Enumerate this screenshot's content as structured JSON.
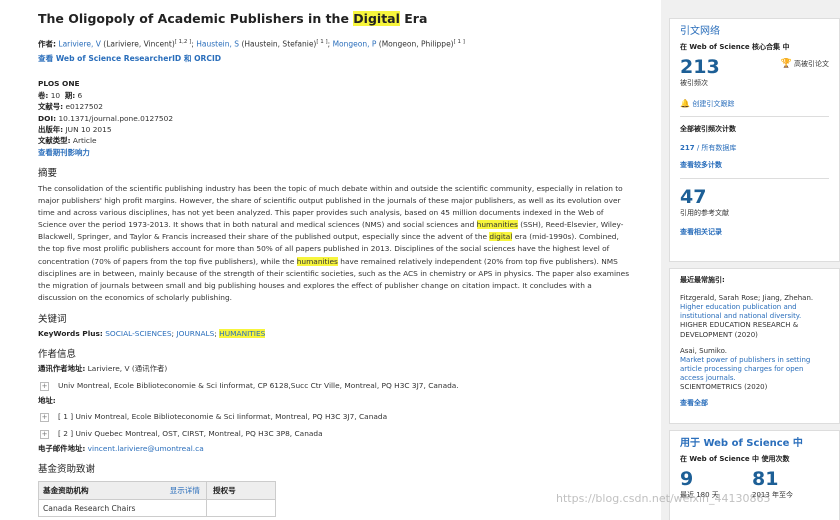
{
  "title": {
    "pre": "The Oligopoly of Academic Publishers in the ",
    "highlight": "Digital",
    "post": " Era"
  },
  "authors": {
    "label": "作者:",
    "a1": "Lariviere, V",
    "a1_full": " (Lariviere, Vincent)",
    "a1_sup": "[ 1,2 ]",
    "a2": "Haustein, S",
    "a2_full": " (Haustein, Stefanie)",
    "a2_sup": "[ 1 ]",
    "a3": "Mongeon, P",
    "a3_full": " (Mongeon, Philippe)",
    "a3_sup": "[ 1 ]",
    "researcher_link": "查看 Web of Science ResearcherID 和 ORCID"
  },
  "meta": {
    "journal": "PLOS ONE",
    "volume_label": "卷:",
    "volume": "10",
    "issue_label": "期:",
    "issue": "6",
    "article_no_label": "文献号:",
    "article_no": "e0127502",
    "doi_label": "DOI:",
    "doi": "10.1371/journal.pone.0127502",
    "pub_date_label": "出版年:",
    "pub_date": "JUN 10 2015",
    "doc_type_label": "文献类型:",
    "doc_type": "Article",
    "impact_link": "查看期刊影响力"
  },
  "abstract": {
    "heading": "摘要",
    "p1": "The consolidation of the scientific publishing industry has been the topic of much debate within and outside the scientific community, especially in relation to major publishers' high profit margins. However, the share of scientific output published in the journals of these major publishers, as well as its evolution over time and across various disciplines, has not yet been analyzed. This paper provides such analysis, based on 45 million documents indexed in the Web of Science over the period 1973-2013. It shows that in both natural and medical sciences (NMS) and social sciences and ",
    "hl1": "humanities",
    "p2": " (SSH), Reed-Elsevier, Wiley-Blackwell, Springer, and Taylor & Francis increased their share of the published output, especially since the advent of the ",
    "hl2": "digital",
    "p3": " era (mid-1990s). Combined, the top five most prolific publishers account for more than 50% of all papers published in 2013. Disciplines of the social sciences have the highest level of concentration (70% of papers from the top five publishers), while the ",
    "hl3": "humanities",
    "p4": " have remained relatively independent (20% from top five publishers). NMS disciplines are in between, mainly because of the strength of their scientific societies, such as the ACS in chemistry or APS in physics. The paper also examines the migration of journals between small and big publishing houses and explores the effect of publisher change on citation impact. It concludes with a discussion on the economics of scholarly publishing."
  },
  "keywords": {
    "heading": "关键词",
    "label": "KeyWords Plus:",
    "k1": "SOCIAL-SCIENCES",
    "sep": "; ",
    "k2": "JOURNALS",
    "sep2": "; ",
    "k3": "HUMANITIES"
  },
  "author_info": {
    "heading": "作者信息",
    "corr_label": "通讯作者地址:",
    "corr_value": "Lariviere, V (通讯作者)",
    "corr_addr": "Univ Montreal, Ecole Biblioteconomie & Sci Iinformat, CP 6128,Succ Ctr Ville, Montreal, PQ H3C 3J7, Canada.",
    "addr_label": "地址:",
    "addr1": "[ 1 ] Univ Montreal, Ecole Biblioteconomie & Sci Iinformat, Montreal, PQ H3C 3J7, Canada",
    "addr2": "[ 2 ] Univ Quebec Montreal, OST, CIRST, Montreal, PQ H3C 3P8, Canada",
    "email_label": "电子邮件地址:",
    "email": "vincent.lariviere@umontreal.ca"
  },
  "funding": {
    "heading": "基金资助致谢",
    "col1": "基金资助机构",
    "show_details": "显示详情",
    "col2": "授权号",
    "row1": "Canada Research Chairs"
  },
  "citation_network": {
    "title": "引文网络",
    "subtitle": "在 Web of Science 核心合集 中",
    "times_cited": "213",
    "times_cited_label": "被引频次",
    "highly_cited": "高被引论文",
    "create_alert": "创建引文跟踪",
    "all_counts_label": "全部被引频次计数",
    "all_db_count": "217",
    "all_db_label": " / 所有数据库",
    "more_counts": "查看较多计数",
    "refs": "47",
    "refs_label": "引用的参考文献",
    "related": "查看相关记录"
  },
  "recent": {
    "title": "最近最常施引:",
    "r1_authors": "Fitzgerald, Sarah Rose; Jiang, Zhehan.",
    "r1_title": "Higher education publication and institutional and national diversity.",
    "r1_source": "HIGHER EDUCATION RESEARCH & DEVELOPMENT (2020)",
    "r2_authors": "Asai, Sumiko.",
    "r2_title": "Market power of publishers in setting article processing charges for open access journals.",
    "r2_source": "SCIENTOMETRICS (2020)",
    "view_all": "查看全部"
  },
  "usage": {
    "title": "用于 Web of Science 中",
    "subtitle": "在 Web of Science 中 使用次数",
    "n1": "9",
    "n1_label": "最近 180 天",
    "n2": "81",
    "n2_label": "2013 年至今"
  },
  "watermark": "https://blog.csdn.net/weixin_44130865"
}
